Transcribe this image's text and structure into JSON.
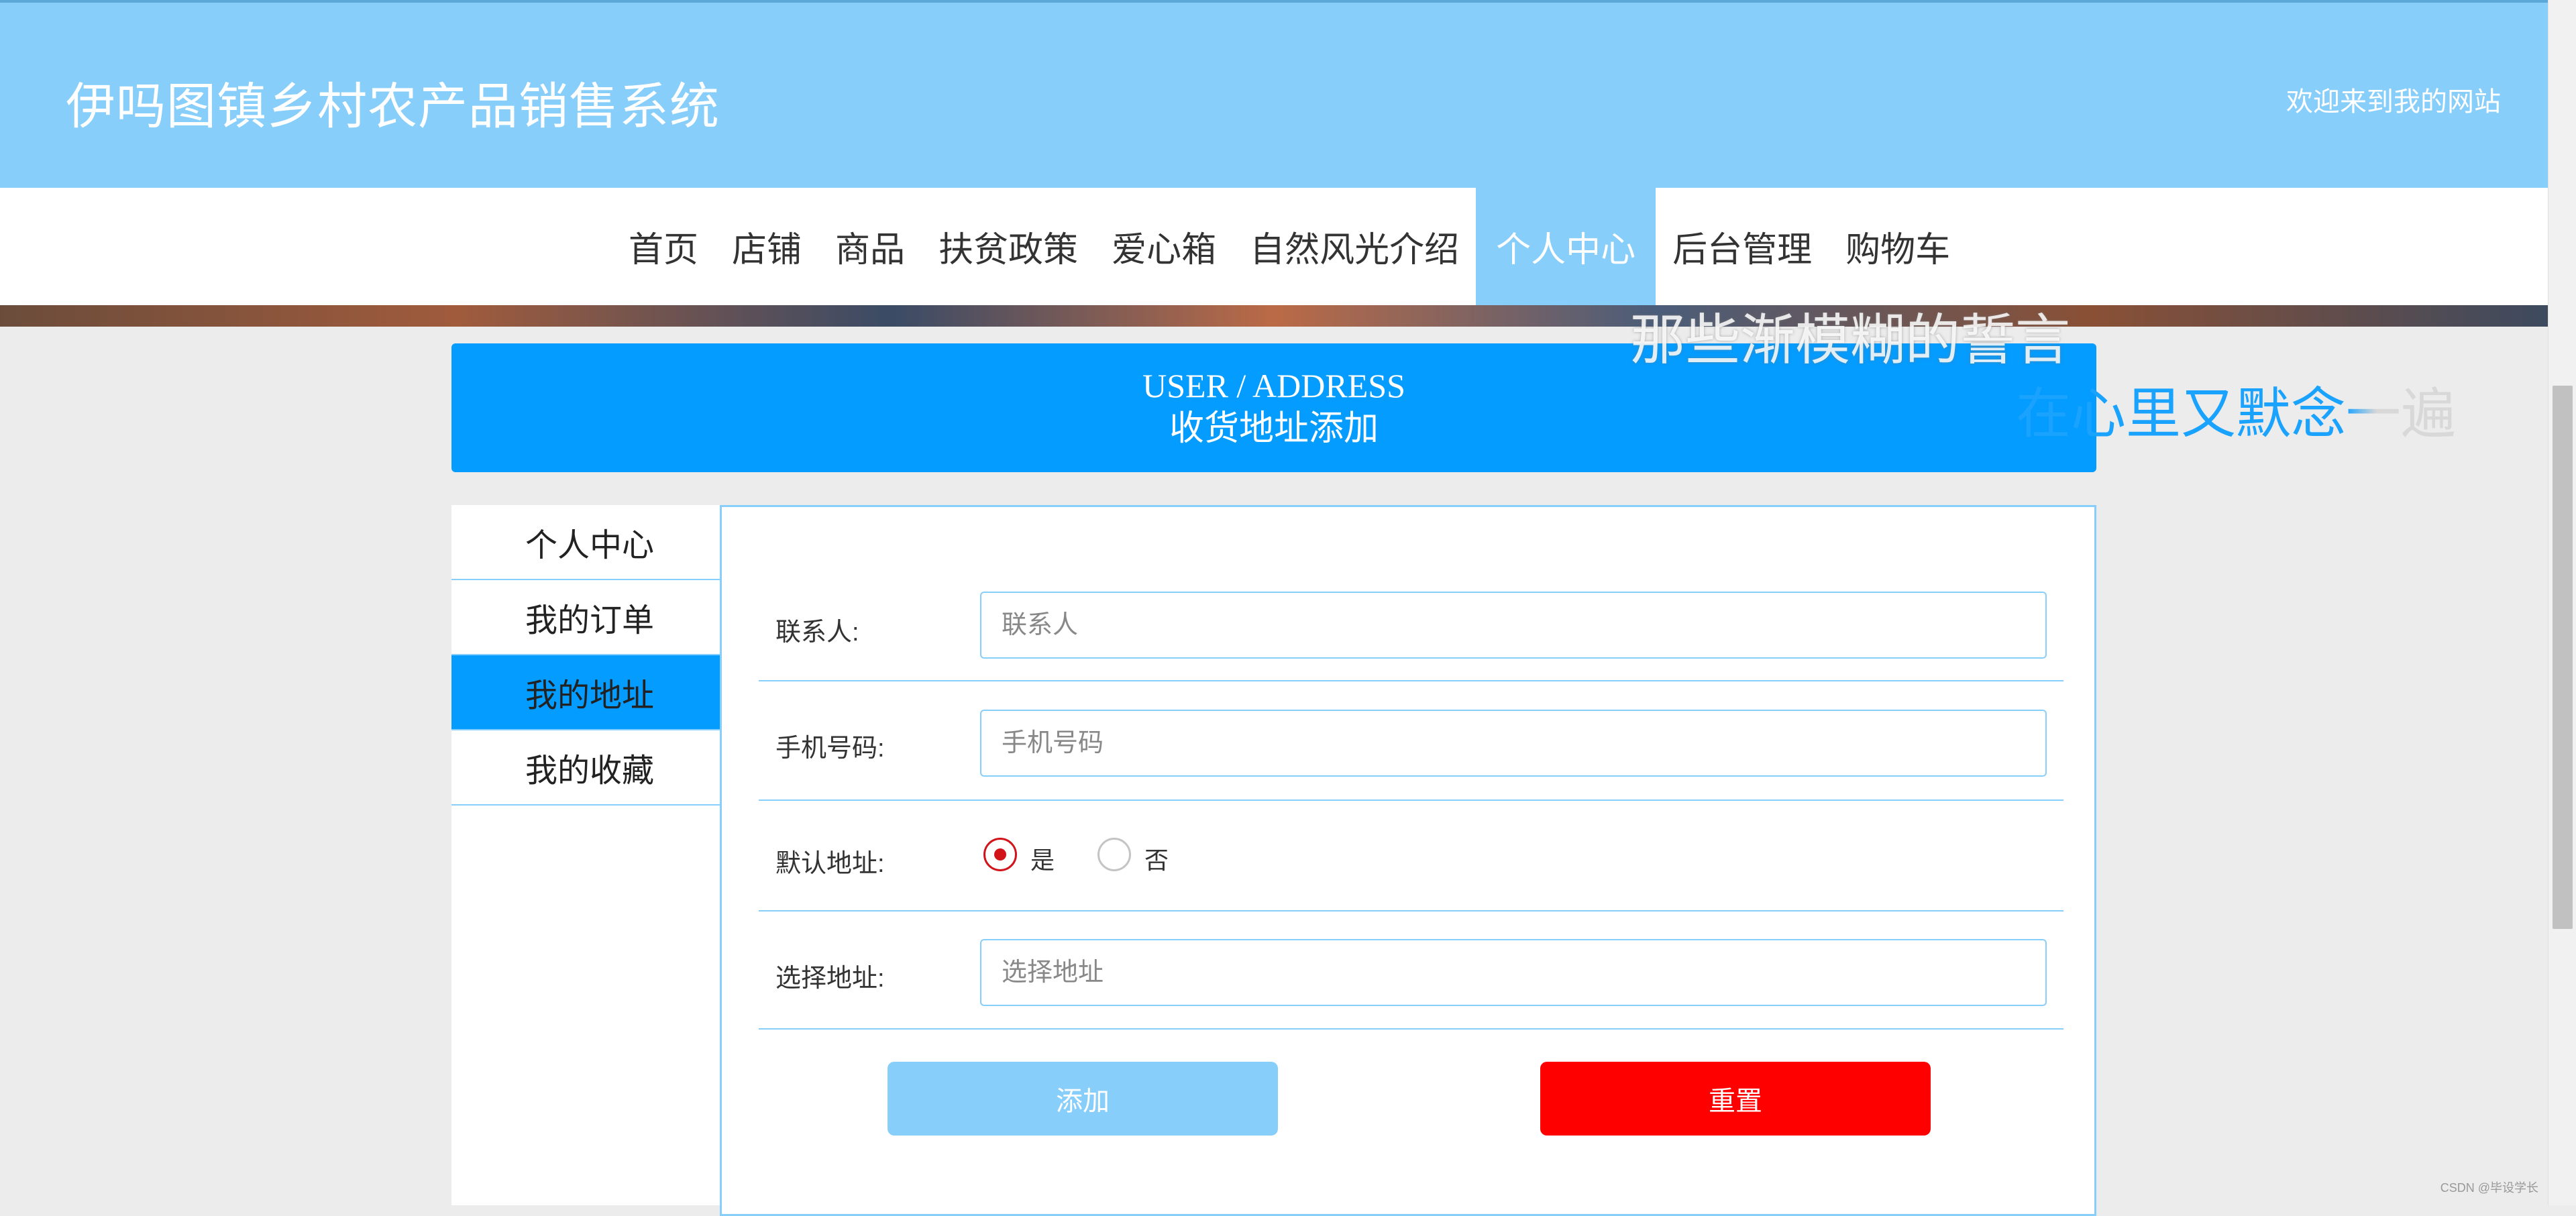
{
  "header": {
    "site_title": "伊吗图镇乡村农产品销售系统",
    "welcome": "欢迎来到我的网站"
  },
  "nav": {
    "items": [
      "首页",
      "店铺",
      "商品",
      "扶贫政策",
      "爱心箱",
      "自然风光介绍",
      "个人中心",
      "后台管理",
      "购物车"
    ],
    "active": "个人中心"
  },
  "overlay": {
    "lyric_line_1": "那些渐模糊的誓言",
    "lyric_line_2": "在心里又默念一遍"
  },
  "title_box": {
    "en": "USER / ADDRESS",
    "cn": "收货地址添加"
  },
  "sidebar": {
    "items": [
      "个人中心",
      "我的订单",
      "我的地址",
      "我的收藏"
    ],
    "active": "我的地址"
  },
  "form": {
    "contact_label": "联系人:",
    "contact_placeholder": "联系人",
    "phone_label": "手机号码:",
    "phone_placeholder": "手机号码",
    "default_label": "默认地址:",
    "default_options": [
      "是",
      "否"
    ],
    "default_selected": "是",
    "address_label": "选择地址:",
    "address_placeholder": "选择地址",
    "add_button": "添加",
    "reset_button": "重置"
  },
  "watermark": "CSDN @毕设学长",
  "colors": {
    "header_bg": "#87cefa",
    "title_box_bg": "#049cff",
    "reset_button": "#ff0000",
    "radio_checked": "#d0141a"
  }
}
